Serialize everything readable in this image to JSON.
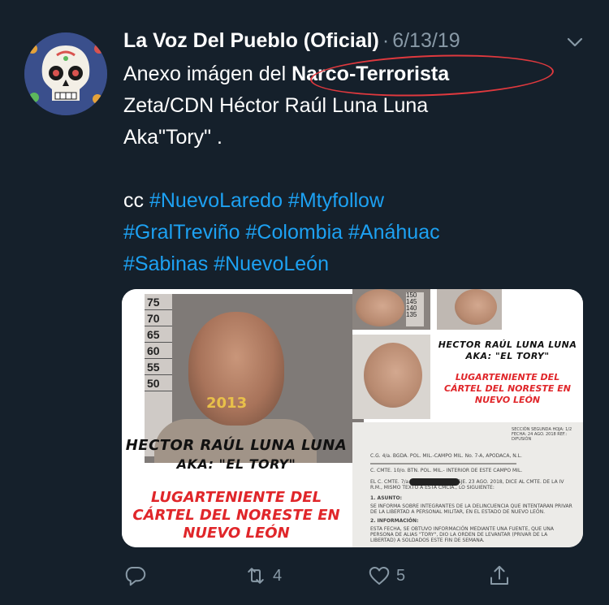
{
  "tweet": {
    "display_name": "La Voz Del Pueblo (Oficial)",
    "separator": "·",
    "date": "6/13/19",
    "line1_prefix": "Anexo imágen del ",
    "line1_highlight": "Narco-Terrorista",
    "line2": "Zeta/CDN Héctor Raúl Luna Luna",
    "line3": "Aka\"Tory\" .",
    "cc_label": "cc",
    "hashtags_line1": [
      "#NuevoLaredo",
      "#Mtyfollow"
    ],
    "hashtags_line2": [
      "#GralTreviño",
      "#Colombia",
      "#Anáhuac"
    ],
    "hashtags_line3": [
      "#Sabinas",
      "#NuevoLeón"
    ]
  },
  "media": {
    "left_panel": {
      "height_marks": [
        "75",
        "70",
        "65",
        "60",
        "55",
        "50"
      ],
      "year": "2013",
      "name_caption": "HECTOR RAÚL LUNA LUNA",
      "aka_caption": "AKA: \"EL TORY\"",
      "role_line1": "LUGARTENIENTE DEL",
      "role_line2": "CÁRTEL DEL NORESTE EN",
      "role_line3": "NUEVO LEÓN"
    },
    "right_top_panel": {
      "ruler_marks": [
        "150",
        "145",
        "140",
        "135"
      ],
      "name_caption": "HECTOR RAÚL LUNA LUNA",
      "aka_caption": "AKA: \"EL TORY\"",
      "role_line1": "LUGARTENIENTE DEL",
      "role_line2": "CÁRTEL DEL NORESTE EN",
      "role_line3": "NUEVO LEÓN"
    },
    "document_panel": {
      "header_right": "SECCIÓN SEGUNDA HOJA: 1/2 FECHA: 24 AGO. 2018 REF.: DIFUSIÓN",
      "line_unit": "C.G. 4/a. BGDA. POL. MIL.-CAMPO MIL. No. 7-A, APODACA, N.L.",
      "line_cmte": "C. CMTE. 10/o. BTN. POL. MIL.- INTERIOR DE ESTE CAMPO MIL.",
      "line_body": "EL C. CMTE. 7/a. Z.M. S-1 E.M. EN MSJE. 23 AGO. 2018, DICE AL CMTE. DE LA IV R.M., MISMO TEXTO A ESTA CMCIA., LO SIGUIENTE:",
      "section1": "1. ASUNTO:",
      "section1_text": "SE INFORMA SOBRE INTEGRANTES DE LA DELINCUENCIA QUE INTENTARAN PRIVAR DE LA LIBERTAD A PERSONAL MILITAR, EN EL ESTADO DE NUEVO LEÓN.",
      "section2": "2. INFORMACIÓN:",
      "section2_text": "ESTA FECHA, SE OBTUVO INFORMACIÓN MEDIANTE UNA FUENTE, QUE UNA PERSONA DE ALIAS \"TORY\", DIO LA ORDEN DE LEVANTAR (PRIVAR DE LA LIBERTAD) A SOLDADOS ESTE FIN DE SEMANA."
    }
  },
  "actions": {
    "reply_count": "",
    "retweet_count": "4",
    "like_count": "5"
  },
  "colors": {
    "background": "#15202b",
    "text": "#ffffff",
    "muted": "#8899a6",
    "link": "#1da1f2",
    "annotation_red": "#e0393e"
  },
  "icons": [
    "chevron-down-icon",
    "reply-icon",
    "retweet-icon",
    "like-icon",
    "share-icon"
  ]
}
